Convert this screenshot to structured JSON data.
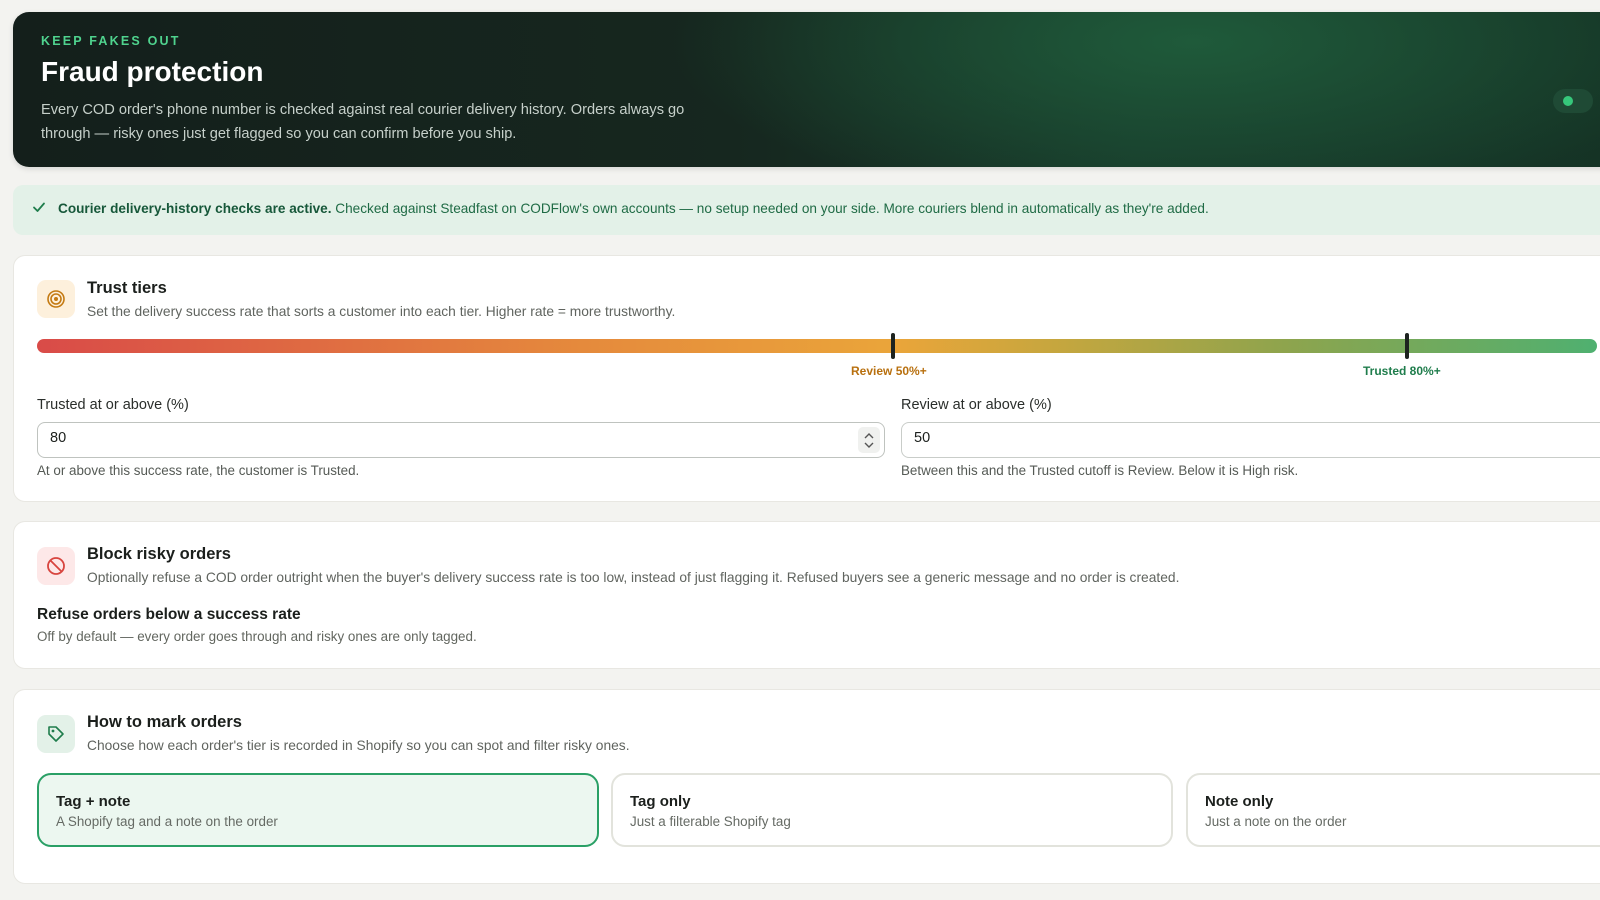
{
  "hero": {
    "eyebrow": "KEEP FAKES OUT",
    "title": "Fraud protection",
    "description": "Every COD order's phone number is checked against real courier delivery history. Orders always go through — risky ones just get flagged so you can confirm before you ship."
  },
  "banner": {
    "strong": "Courier delivery-history checks are active.",
    "text": " Checked against Steadfast on CODFlow's own accounts — no setup needed on your side. More couriers blend in automatically as they're added."
  },
  "trust_tiers": {
    "title": "Trust tiers",
    "subtitle": "Set the delivery success rate that sorts a customer into each tier. Higher rate = more trustworthy.",
    "review_marker": {
      "label": "Review 50%+",
      "value": 50,
      "color": "#b8700f"
    },
    "trusted_marker": {
      "label": "Trusted 80%+",
      "value": 80,
      "color": "#1f7d4c"
    },
    "trusted_field": {
      "label": "Trusted at or above (%)",
      "value": "80",
      "help": "At or above this success rate, the customer is Trusted."
    },
    "review_field": {
      "label": "Review at or above (%)",
      "value": "50",
      "help": "Between this and the Trusted cutoff is Review. Below it is High risk."
    }
  },
  "block_risky": {
    "title": "Block risky orders",
    "subtitle": "Optionally refuse a COD order outright when the buyer's delivery success rate is too low, instead of just flagging it. Refused buyers see a generic message and no order is created.",
    "option_title": "Refuse orders below a success rate",
    "option_sub": "Off by default — every order goes through and risky ones are only tagged."
  },
  "mark_orders": {
    "title": "How to mark orders",
    "subtitle": "Choose how each order's tier is recorded in Shopify so you can spot and filter risky ones.",
    "choices": [
      {
        "title": "Tag + note",
        "sub": "A Shopify tag and a note on the order",
        "selected": true
      },
      {
        "title": "Tag only",
        "sub": "Just a filterable Shopify tag",
        "selected": false
      },
      {
        "title": "Note only",
        "sub": "Just a note on the order",
        "selected": false
      }
    ]
  },
  "colors": {
    "accent": "#2aa066",
    "hero_eyebrow": "#4fd38e",
    "banner_bg": "#e3f1e8"
  }
}
